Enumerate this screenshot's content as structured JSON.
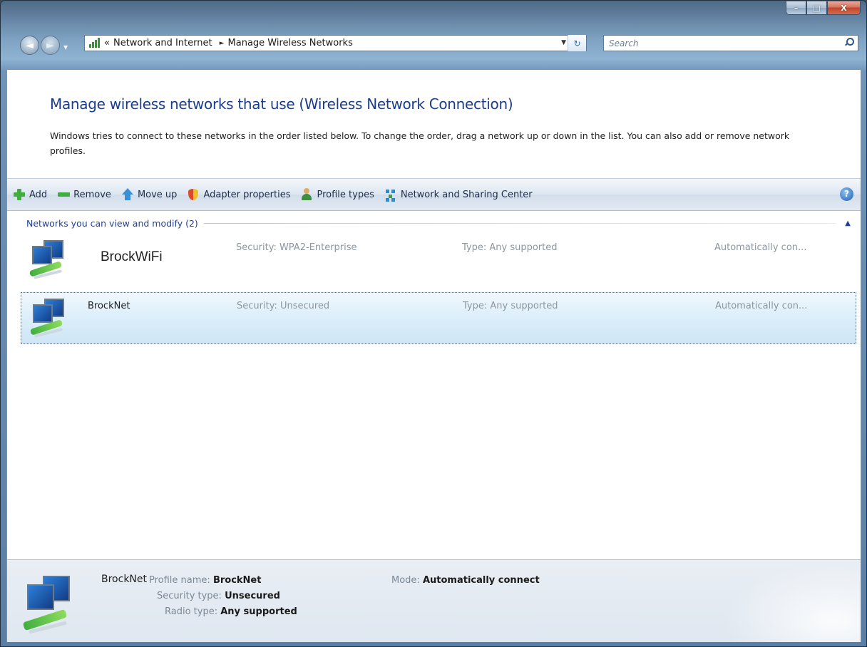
{
  "window": {
    "controls": {
      "minimize": "–",
      "maximize": "□",
      "close": "X"
    }
  },
  "nav": {
    "back_icon": "back-arrow-icon",
    "forward_icon": "forward-arrow-icon",
    "address": {
      "overflow": "«",
      "crumb1": "Network and Internet",
      "separator": "►",
      "crumb2": "Manage Wireless Networks"
    },
    "search_placeholder": "Search"
  },
  "header": {
    "title": "Manage wireless networks that use (Wireless Network Connection)",
    "description": "Windows tries to connect to these networks in the order listed below. To change the order, drag a network up or down in the list. You can also add or remove network profiles."
  },
  "toolbar": {
    "add": "Add",
    "remove": "Remove",
    "move_up": "Move up",
    "adapter_properties": "Adapter properties",
    "profile_types": "Profile types",
    "network_sharing": "Network and Sharing Center",
    "help": "?"
  },
  "list": {
    "group_label": "Networks you can view and modify (2)",
    "networks": [
      {
        "name": "BrockWiFi",
        "security": "Security: WPA2-Enterprise",
        "type": "Type: Any supported",
        "mode": "Automatically con..."
      },
      {
        "name": "BrockNet",
        "security": "Security: Unsecured",
        "type": "Type: Any supported",
        "mode": "Automatically con..."
      }
    ]
  },
  "details": {
    "name": "BrockNet",
    "profile_name_label": "Profile name:",
    "profile_name": "BrockNet",
    "security_type_label": "Security type:",
    "security_type": "Unsecured",
    "radio_type_label": "Radio type:",
    "radio_type": "Any supported",
    "mode_label": "Mode:",
    "mode": "Automatically connect"
  }
}
